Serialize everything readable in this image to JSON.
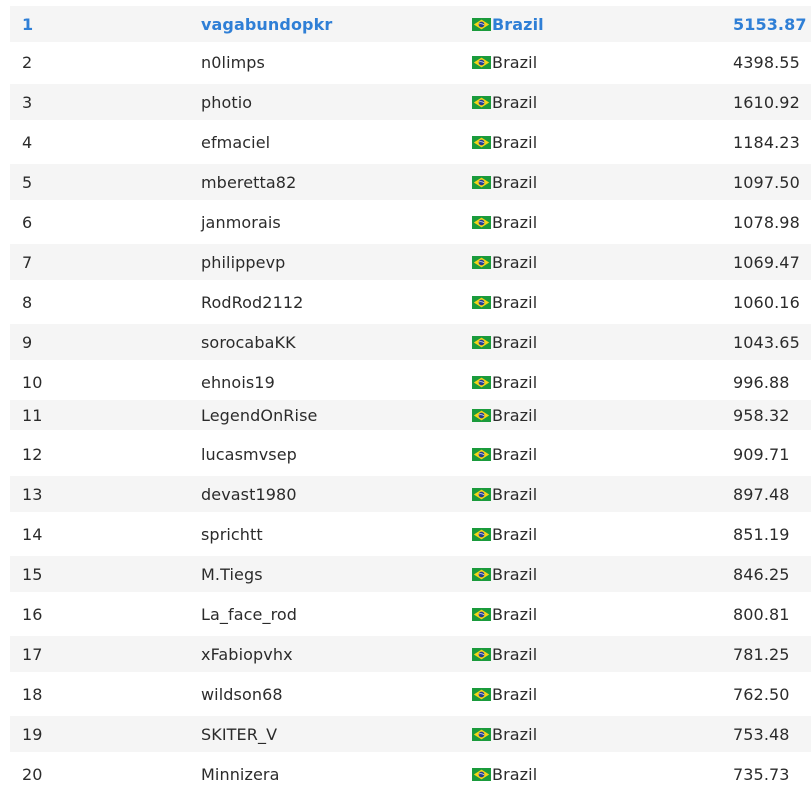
{
  "leaderboard": {
    "rows": [
      {
        "rank": "1",
        "player": "vagabundopkr",
        "country": "Brazil",
        "flag_icon": "brazil-flag-icon",
        "score": "5153.87"
      },
      {
        "rank": "2",
        "player": "n0limps",
        "country": "Brazil",
        "flag_icon": "brazil-flag-icon",
        "score": "4398.55"
      },
      {
        "rank": "3",
        "player": "photio",
        "country": "Brazil",
        "flag_icon": "brazil-flag-icon",
        "score": "1610.92"
      },
      {
        "rank": "4",
        "player": "efmaciel",
        "country": "Brazil",
        "flag_icon": "brazil-flag-icon",
        "score": "1184.23"
      },
      {
        "rank": "5",
        "player": "mberetta82",
        "country": "Brazil",
        "flag_icon": "brazil-flag-icon",
        "score": "1097.50"
      },
      {
        "rank": "6",
        "player": "janmorais",
        "country": "Brazil",
        "flag_icon": "brazil-flag-icon",
        "score": "1078.98"
      },
      {
        "rank": "7",
        "player": "philippevp",
        "country": "Brazil",
        "flag_icon": "brazil-flag-icon",
        "score": "1069.47"
      },
      {
        "rank": "8",
        "player": "RodRod2112",
        "country": "Brazil",
        "flag_icon": "brazil-flag-icon",
        "score": "1060.16"
      },
      {
        "rank": "9",
        "player": "sorocabaKK",
        "country": "Brazil",
        "flag_icon": "brazil-flag-icon",
        "score": "1043.65"
      },
      {
        "rank": "10",
        "player": "ehnois19",
        "country": "Brazil",
        "flag_icon": "brazil-flag-icon",
        "score": "996.88"
      },
      {
        "rank": "11",
        "player": "LegendOnRise",
        "country": "Brazil",
        "flag_icon": "brazil-flag-icon",
        "score": "958.32"
      },
      {
        "rank": "12",
        "player": "lucasmvsep",
        "country": "Brazil",
        "flag_icon": "brazil-flag-icon",
        "score": "909.71"
      },
      {
        "rank": "13",
        "player": "devast1980",
        "country": "Brazil",
        "flag_icon": "brazil-flag-icon",
        "score": "897.48"
      },
      {
        "rank": "14",
        "player": "sprichtt",
        "country": "Brazil",
        "flag_icon": "brazil-flag-icon",
        "score": "851.19"
      },
      {
        "rank": "15",
        "player": "M.Tiegs",
        "country": "Brazil",
        "flag_icon": "brazil-flag-icon",
        "score": "846.25"
      },
      {
        "rank": "16",
        "player": "La_face_rod",
        "country": "Brazil",
        "flag_icon": "brazil-flag-icon",
        "score": "800.81"
      },
      {
        "rank": "17",
        "player": "xFabiopvhx",
        "country": "Brazil",
        "flag_icon": "brazil-flag-icon",
        "score": "781.25"
      },
      {
        "rank": "18",
        "player": "wildson68",
        "country": "Brazil",
        "flag_icon": "brazil-flag-icon",
        "score": "762.50"
      },
      {
        "rank": "19",
        "player": "SKITER_V",
        "country": "Brazil",
        "flag_icon": "brazil-flag-icon",
        "score": "753.48"
      },
      {
        "rank": "20",
        "player": "Minnizera",
        "country": "Brazil",
        "flag_icon": "brazil-flag-icon",
        "score": "735.73"
      }
    ]
  },
  "colors": {
    "leader_text": "#2f7fd6",
    "row_shade": "#f5f5f5",
    "text": "#2b2b2b",
    "flag_green": "#1a9b3c",
    "flag_yellow": "#f7d417",
    "flag_blue": "#253d8f"
  }
}
